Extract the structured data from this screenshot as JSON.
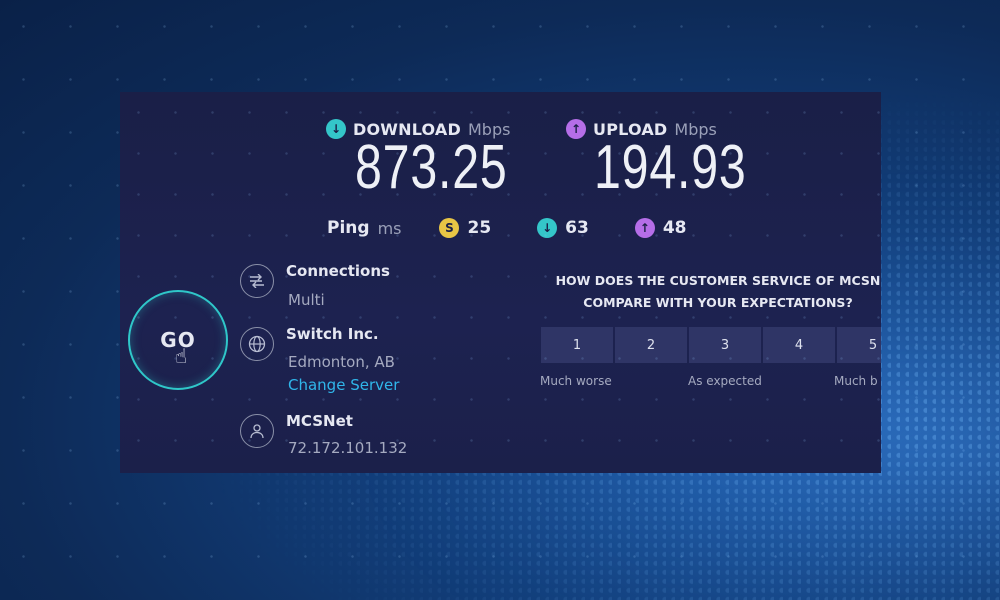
{
  "speedtest": {
    "download": {
      "label": "DOWNLOAD",
      "unit": "Mbps",
      "value": "873.25",
      "color": "#34c6c9"
    },
    "upload": {
      "label": "UPLOAD",
      "unit": "Mbps",
      "value": "194.93",
      "color": "#b56ee8"
    },
    "ping": {
      "label": "Ping",
      "unit": "ms",
      "values": [
        {
          "icon": "ping-idle-icon",
          "value": "25",
          "color": "#e8c545"
        },
        {
          "icon": "ping-download-icon",
          "value": "63",
          "color": "#34c6c9"
        },
        {
          "icon": "ping-upload-icon",
          "value": "48",
          "color": "#b56ee8"
        }
      ]
    },
    "go_label": "GO",
    "connections": {
      "title": "Connections",
      "value": "Multi"
    },
    "server": {
      "title": "Switch Inc.",
      "location": "Edmonton, AB",
      "change_label": "Change Server"
    },
    "provider": {
      "title": "MCSNet",
      "ip": "72.172.101.132"
    }
  },
  "survey": {
    "question_line1": "HOW DOES THE CUSTOMER SERVICE OF MCSN",
    "question_line2": "COMPARE WITH YOUR EXPECTATIONS?",
    "scale": [
      "1",
      "2",
      "3",
      "4",
      "5"
    ],
    "low_label": "Much worse",
    "mid_label": "As expected",
    "high_label": "Much b"
  }
}
